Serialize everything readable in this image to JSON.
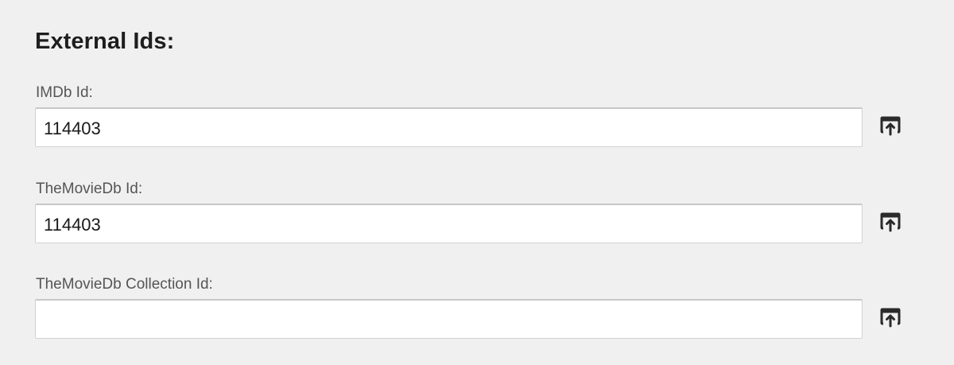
{
  "section": {
    "title": "External Ids:"
  },
  "fields": [
    {
      "label": "IMDb Id:",
      "value": "114403",
      "placeholder": "",
      "action_icon": "open-in-browser-icon"
    },
    {
      "label": "TheMovieDb Id:",
      "value": "114403",
      "placeholder": "",
      "action_icon": "open-in-browser-icon"
    },
    {
      "label": "TheMovieDb Collection Id:",
      "value": "",
      "placeholder": "",
      "action_icon": "open-in-browser-icon"
    }
  ],
  "colors": {
    "background": "#f0f0f0",
    "title": "#1e1e1e",
    "label": "#555555",
    "input_background": "#ffffff",
    "input_border": "#d2d2d2",
    "icon": "#2a2a2a"
  }
}
